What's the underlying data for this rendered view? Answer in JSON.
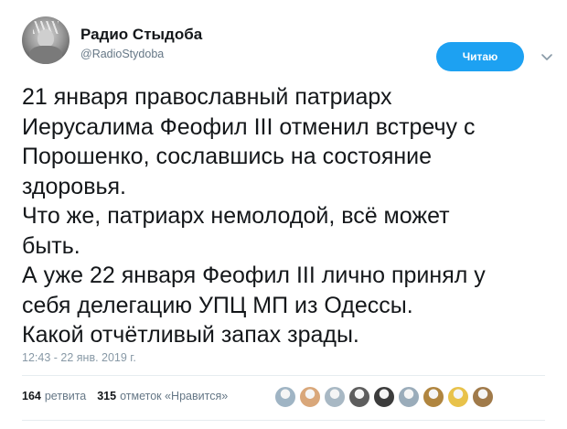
{
  "account": {
    "name": "Радио Стыдоба",
    "handle": "@RadioStydoba"
  },
  "follow_button": {
    "label": "Читаю"
  },
  "tweet": {
    "text": "21 января православный патриарх\nИерусалима Феофил III отменил встречу с\nПорошенко, сославшись на состояние\nздоровья.\nЧто же, патриарх немолодой, всё может\nбыть.\nА уже 22 января Феофил III лично принял у\nсебя делегацию УПЦ МП из Одессы.\nКакой отчётливый запах зрады.",
    "timestamp": "12:43 - 22 янв. 2019 г."
  },
  "stats": {
    "retweets_count": "164",
    "retweets_label": "ретвита",
    "likes_count": "315",
    "likes_label": "отметок «Нравится»"
  },
  "liker_avatars": [
    {
      "icon": "default-avatar-icon",
      "color": "#9fb4c4"
    },
    {
      "icon": "cat-avatar-icon",
      "color": "#d9a77a"
    },
    {
      "icon": "default-avatar-icon",
      "color": "#a8b8c4"
    },
    {
      "icon": "photo-avatar-icon",
      "color": "#5d5d5d"
    },
    {
      "icon": "photo-avatar-icon",
      "color": "#3c3c3c"
    },
    {
      "icon": "default-avatar-icon",
      "color": "#9aacba"
    },
    {
      "icon": "photo-avatar-icon",
      "color": "#b0853f"
    },
    {
      "icon": "pepper-avatar-icon",
      "color": "#e8c24a"
    },
    {
      "icon": "photo-avatar-icon",
      "color": "#a07a4a"
    }
  ],
  "colors": {
    "accent": "#1da1f2",
    "text": "#14171a",
    "secondary": "#657786"
  }
}
